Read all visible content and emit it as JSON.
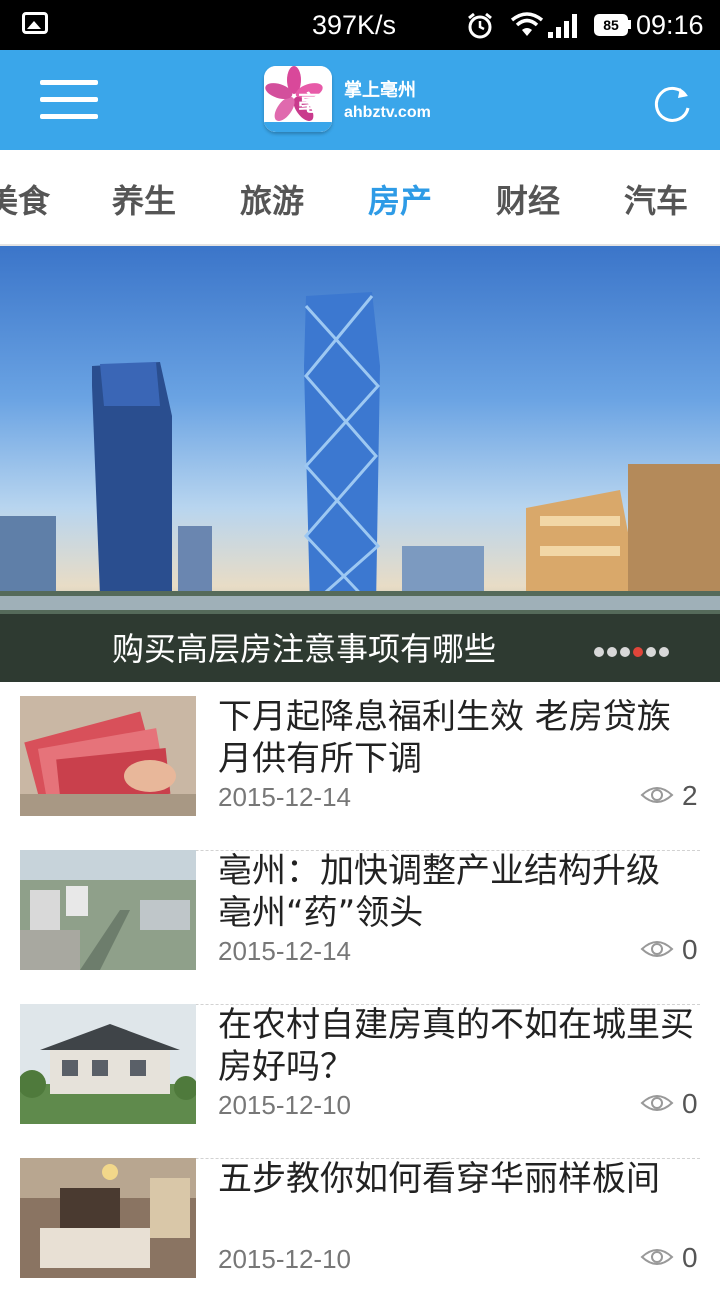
{
  "status_bar": {
    "network_speed": "397K/s",
    "battery": "85",
    "time": "09:16",
    "icons": [
      "image-icon",
      "alarm-icon",
      "wifi-icon",
      "signal-icon",
      "battery-icon"
    ]
  },
  "header": {
    "app_name": "掌上亳州",
    "site": "ahbztv.com",
    "logo_char": "亳",
    "menu_icon": "hamburger-menu-icon",
    "refresh_icon": "refresh-icon",
    "colors": {
      "bar": "#3aa6ea",
      "accent": "#2e9be6"
    }
  },
  "tabs": {
    "items": [
      {
        "label": "美食"
      },
      {
        "label": "养生"
      },
      {
        "label": "旅游"
      },
      {
        "label": "房产"
      },
      {
        "label": "财经"
      },
      {
        "label": "汽车"
      }
    ],
    "active": "房产"
  },
  "banner": {
    "caption": "购买高层房注意事项有哪些",
    "slide_count": 6,
    "active_slide": 4
  },
  "news": [
    {
      "title": "下月起降息福利生效 老房贷族月供有所下调",
      "date": "2015-12-14",
      "views": "2",
      "thumb": "money-photo"
    },
    {
      "title": "亳州：加快调整产业结构升级 亳州“药”领头",
      "date": "2015-12-14",
      "views": "0",
      "thumb": "city-aerial-photo"
    },
    {
      "title": "在农村自建房真的不如在城里买房好吗？",
      "date": "2015-12-10",
      "views": "0",
      "thumb": "villa-photo"
    },
    {
      "title": "五步教你如何看穿华丽样板间",
      "date": "2015-12-10",
      "views": "0",
      "thumb": "bedroom-photo"
    }
  ]
}
